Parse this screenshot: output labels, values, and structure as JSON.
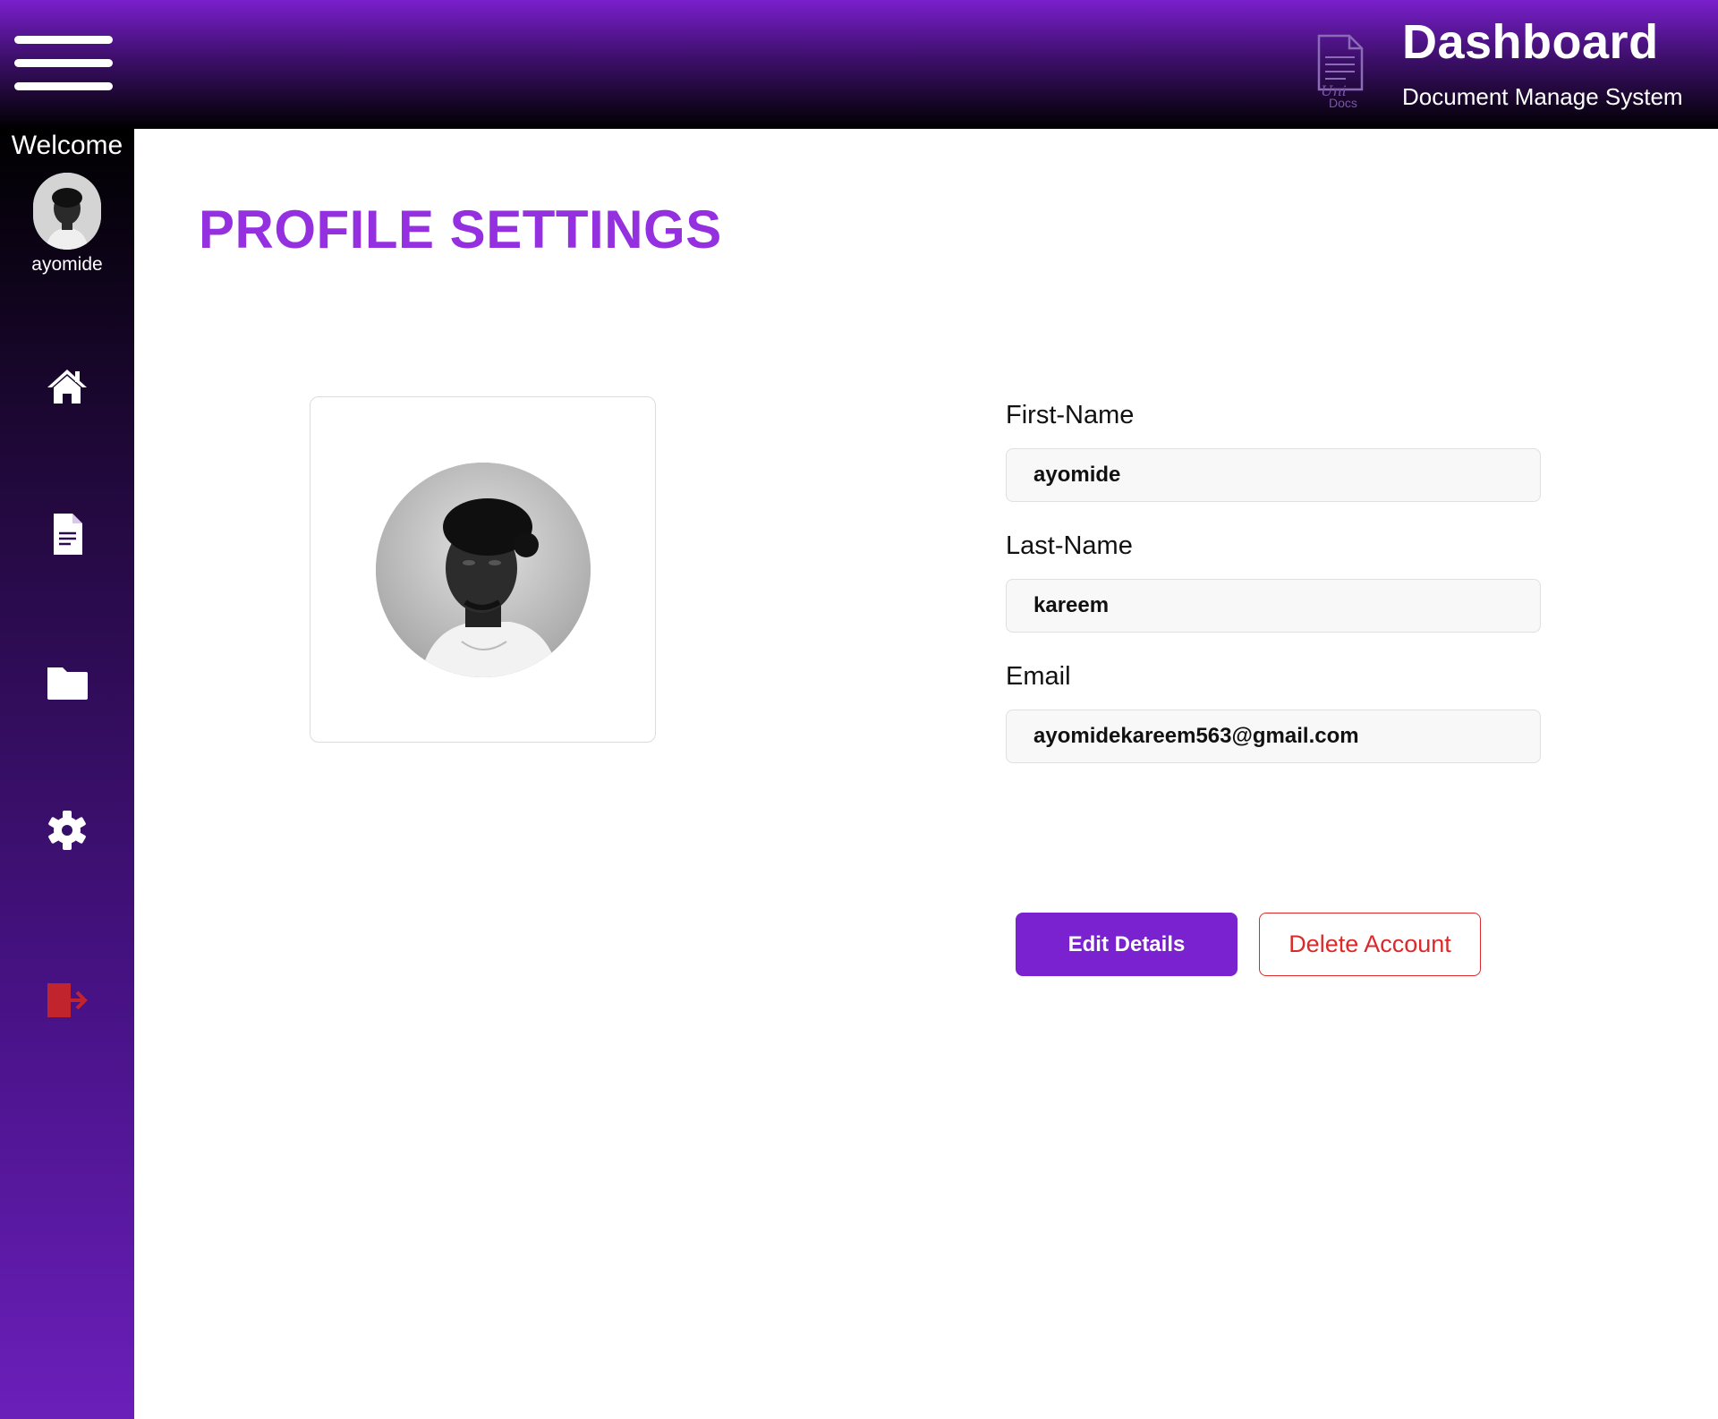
{
  "header": {
    "title": "Dashboard",
    "subtitle": "Document Manage System",
    "logo_text_top": "Uni",
    "logo_text_bottom": "Docs",
    "menu_icon": "hamburger-menu-icon"
  },
  "sidebar": {
    "welcome": "Welcome",
    "username": "ayomide",
    "items": [
      {
        "icon": "home-icon"
      },
      {
        "icon": "document-icon"
      },
      {
        "icon": "folder-icon"
      },
      {
        "icon": "gear-icon"
      },
      {
        "icon": "logout-icon"
      }
    ]
  },
  "main": {
    "title": "PROFILE SETTINGS",
    "fields": {
      "first_name_label": "First-Name",
      "first_name_value": "ayomide",
      "last_name_label": "Last-Name",
      "last_name_value": "kareem",
      "email_label": "Email",
      "email_value": "ayomidekareem563@gmail.com"
    },
    "buttons": {
      "edit": "Edit Details",
      "delete": "Delete Account"
    }
  },
  "colors": {
    "accent": "#9530e0",
    "button_primary": "#7a22cf",
    "danger": "#dc2a2a",
    "header_top": "#7a1fcc",
    "sidebar_bottom": "#6b1fba"
  }
}
